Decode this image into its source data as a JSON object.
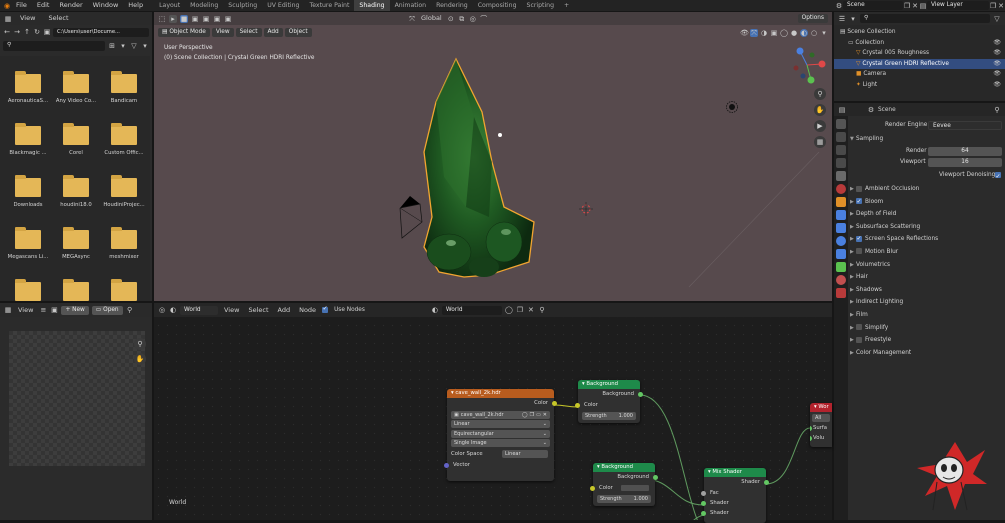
{
  "menubar": {
    "items": [
      "File",
      "Edit",
      "Render",
      "Window",
      "Help"
    ],
    "workspaces": [
      "Layout",
      "Modeling",
      "Sculpting",
      "UV Editing",
      "Texture Paint",
      "Shading",
      "Animation",
      "Rendering",
      "Compositing",
      "Scripting"
    ],
    "active_workspace": "Shading",
    "add_tab": "+",
    "scene": "Scene",
    "view_layer": "View Layer"
  },
  "file_browser": {
    "view": "View",
    "select": "Select",
    "path": "C:\\Users\\user\\Docume...",
    "folders": [
      "AeronauticaS...",
      "Any Video Co...",
      "Bandicam",
      "Blackmagic ...",
      "Corel",
      "Custom Offic...",
      "Downloads",
      "houdini18.0",
      "HoudiniProjec...",
      "Megascans Li...",
      "MEGAsync",
      "meshmixer",
      "",
      "",
      ""
    ]
  },
  "image_editor": {
    "view": "View",
    "new": "New",
    "open": "Open"
  },
  "viewport": {
    "mode": "Object Mode",
    "menus": [
      "View",
      "Select",
      "Add",
      "Object"
    ],
    "transform": "Global",
    "options": "Options",
    "perspective": "User Perspective",
    "collection_info": "(0) Scene Collection | Crystal Green HDRI Reflective"
  },
  "outliner": {
    "items": [
      {
        "label": "Scene Collection",
        "level": 0
      },
      {
        "label": "Collection",
        "level": 1
      },
      {
        "label": "Crystal 005 Roughness",
        "level": 2
      },
      {
        "label": "Crystal Green HDRI Reflective",
        "level": 2,
        "selected": true
      },
      {
        "label": "Camera",
        "level": 2
      },
      {
        "label": "Light",
        "level": 2
      }
    ]
  },
  "properties": {
    "scene": "Scene",
    "render_engine_label": "Render Engine",
    "render_engine": "Eevee",
    "sampling": "Sampling",
    "render_label": "Render",
    "render_value": "64",
    "viewport_label": "Viewport",
    "viewport_value": "16",
    "denoise_label": "Viewport Denoising",
    "panels": [
      {
        "label": "Ambient Occlusion",
        "checkbox": true,
        "checked": false
      },
      {
        "label": "Bloom",
        "checkbox": true,
        "checked": true
      },
      {
        "label": "Depth of Field",
        "checkbox": false
      },
      {
        "label": "Subsurface Scattering",
        "checkbox": false
      },
      {
        "label": "Screen Space Reflections",
        "checkbox": true,
        "checked": true
      },
      {
        "label": "Motion Blur",
        "checkbox": true,
        "checked": false
      },
      {
        "label": "Volumetrics",
        "checkbox": false
      },
      {
        "label": "Hair",
        "checkbox": false
      },
      {
        "label": "Shadows",
        "checkbox": false
      },
      {
        "label": "Indirect Lighting",
        "checkbox": false
      },
      {
        "label": "Film",
        "checkbox": false
      },
      {
        "label": "Simplify",
        "checkbox": true,
        "checked": false
      },
      {
        "label": "Freestyle",
        "checkbox": true,
        "checked": false
      },
      {
        "label": "Color Management",
        "checkbox": false
      }
    ]
  },
  "node_editor": {
    "type": "World",
    "menus": [
      "View",
      "Select",
      "Add",
      "Node"
    ],
    "use_nodes": "Use Nodes",
    "world_name": "World",
    "footer": "World",
    "env_node": {
      "title": "cave_wall_2k.hdr",
      "color_out": "Color",
      "image": "cave_wall_2k.hdr",
      "interp": "Linear",
      "projection": "Equirectangular",
      "source": "Single Image",
      "color_space_label": "Color Space",
      "color_space": "Linear",
      "vector": "Vector"
    },
    "bg1": {
      "title": "Background",
      "out": "Background",
      "color": "Color",
      "strength_label": "Strength",
      "strength": "1.000"
    },
    "bg2": {
      "title": "Background",
      "out": "Background",
      "color": "Color",
      "strength_label": "Strength",
      "strength": "1.000"
    },
    "mix": {
      "title": "Mix Shader",
      "out": "Shader",
      "fac": "Fac",
      "s1": "Shader",
      "s2": "Shader"
    },
    "output": {
      "title": "Wor",
      "target": "All",
      "surface": "Surfa",
      "volume": "Volu"
    }
  },
  "colors": {
    "accent": "#4772b3",
    "image_node": "#b85c1e",
    "shader_node": "#1e8a4a",
    "output_node": "#b2232d",
    "selection_outline": "#f2a530"
  }
}
